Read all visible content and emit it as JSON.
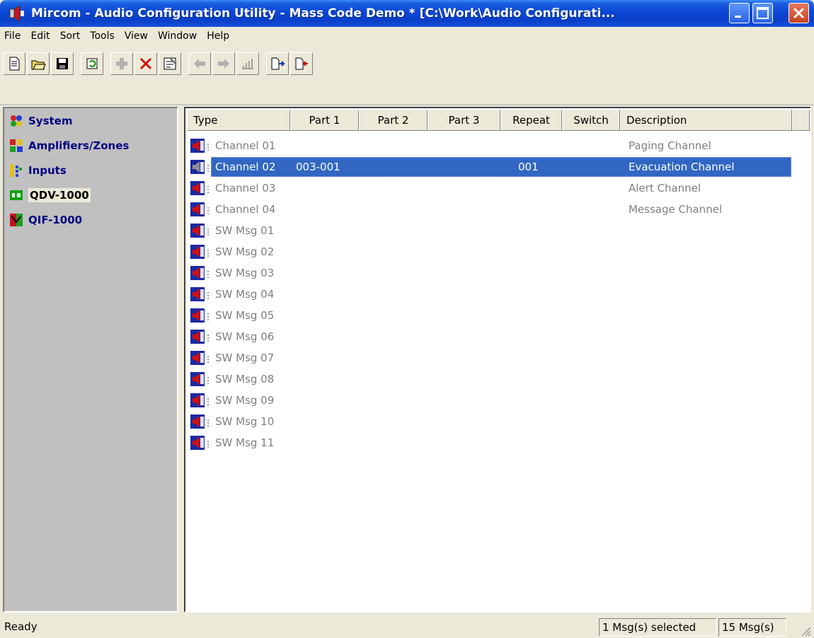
{
  "window": {
    "title": "Mircom - Audio Configuration Utility - Mass Code Demo * [C:\\Work\\Audio Configurati..."
  },
  "menu": [
    "File",
    "Edit",
    "Sort",
    "Tools",
    "View",
    "Window",
    "Help"
  ],
  "toolbar": {
    "buttons": [
      "new-icon",
      "open-icon",
      "save-icon",
      "refresh-icon",
      "add-icon",
      "delete-icon",
      "properties-icon",
      "back-icon",
      "forward-icon",
      "level-icon",
      "export-icon",
      "import-icon"
    ]
  },
  "nav": [
    {
      "label": "System",
      "icon": "system-icon",
      "color": "#000080"
    },
    {
      "label": "Amplifiers/Zones",
      "icon": "amplifiers-icon",
      "color": "#000080"
    },
    {
      "label": "Inputs",
      "icon": "inputs-icon",
      "color": "#000080"
    },
    {
      "label": "QDV-1000",
      "icon": "qdv-icon",
      "color": "#000000"
    },
    {
      "label": "QIF-1000",
      "icon": "qif-icon",
      "color": "#000080"
    }
  ],
  "table": {
    "columns": [
      "Type",
      "Part 1",
      "Part 2",
      "Part 3",
      "Repeat",
      "Switch",
      "Description"
    ],
    "rows": [
      {
        "type": "Channel 01",
        "part1": "",
        "part2": "",
        "part3": "",
        "repeat": "",
        "switch": "",
        "description": "Paging Channel"
      },
      {
        "type": "Channel 02",
        "part1": "003-001",
        "part2": "",
        "part3": "",
        "repeat": "001",
        "switch": "",
        "description": "Evacuation Channel"
      },
      {
        "type": "Channel 03",
        "part1": "",
        "part2": "",
        "part3": "",
        "repeat": "",
        "switch": "",
        "description": "Alert Channel"
      },
      {
        "type": "Channel 04",
        "part1": "",
        "part2": "",
        "part3": "",
        "repeat": "",
        "switch": "",
        "description": "Message Channel"
      },
      {
        "type": "SW Msg 01",
        "part1": "",
        "part2": "",
        "part3": "",
        "repeat": "",
        "switch": "",
        "description": ""
      },
      {
        "type": "SW Msg 02",
        "part1": "",
        "part2": "",
        "part3": "",
        "repeat": "",
        "switch": "",
        "description": ""
      },
      {
        "type": "SW Msg 03",
        "part1": "",
        "part2": "",
        "part3": "",
        "repeat": "",
        "switch": "",
        "description": ""
      },
      {
        "type": "SW Msg 04",
        "part1": "",
        "part2": "",
        "part3": "",
        "repeat": "",
        "switch": "",
        "description": ""
      },
      {
        "type": "SW Msg 05",
        "part1": "",
        "part2": "",
        "part3": "",
        "repeat": "",
        "switch": "",
        "description": ""
      },
      {
        "type": "SW Msg 06",
        "part1": "",
        "part2": "",
        "part3": "",
        "repeat": "",
        "switch": "",
        "description": ""
      },
      {
        "type": "SW Msg 07",
        "part1": "",
        "part2": "",
        "part3": "",
        "repeat": "",
        "switch": "",
        "description": ""
      },
      {
        "type": "SW Msg 08",
        "part1": "",
        "part2": "",
        "part3": "",
        "repeat": "",
        "switch": "",
        "description": ""
      },
      {
        "type": "SW Msg 09",
        "part1": "",
        "part2": "",
        "part3": "",
        "repeat": "",
        "switch": "",
        "description": ""
      },
      {
        "type": "SW Msg 10",
        "part1": "",
        "part2": "",
        "part3": "",
        "repeat": "",
        "switch": "",
        "description": ""
      },
      {
        "type": "SW Msg 11",
        "part1": "",
        "part2": "",
        "part3": "",
        "repeat": "",
        "switch": "",
        "description": ""
      }
    ],
    "selected_index": 1,
    "selection_color": "#3167c3"
  },
  "status": {
    "text": "Ready",
    "selected": "1 Msg(s) selected",
    "total": "15 Msg(s)"
  }
}
